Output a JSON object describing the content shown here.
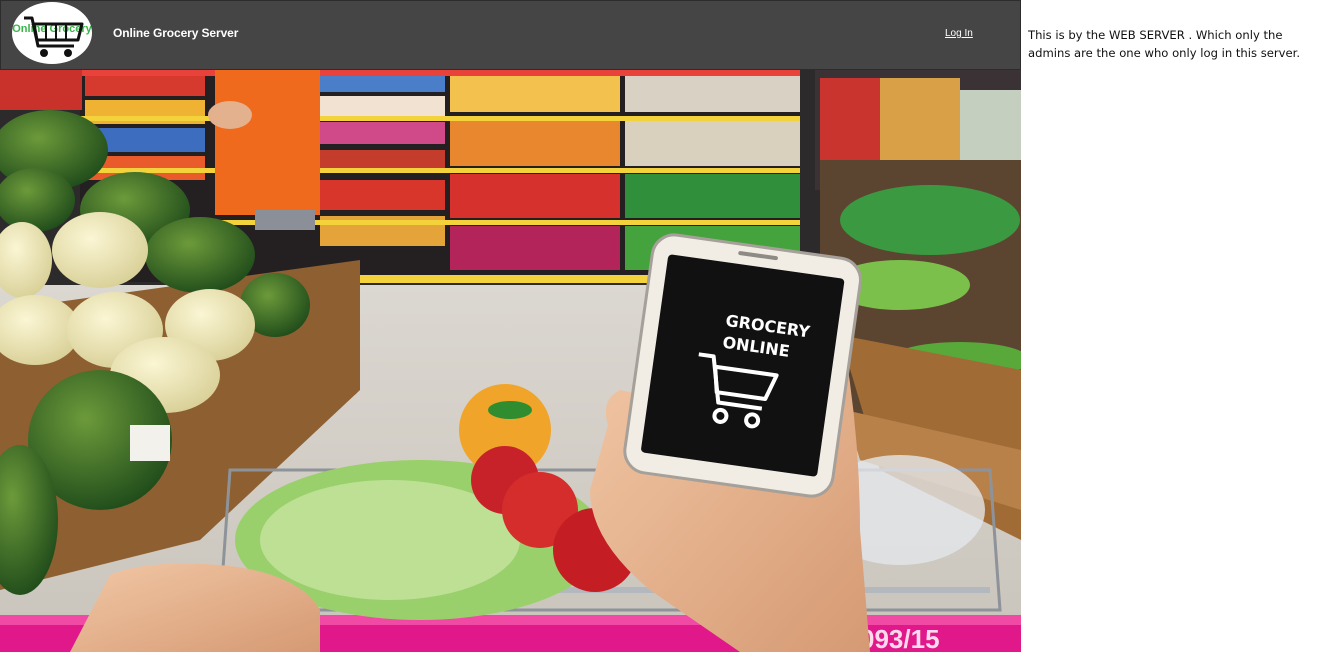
{
  "header": {
    "logo_text": "Online Grocery",
    "title": "Online Grocery Server",
    "login_label": "Log In"
  },
  "hero": {
    "phone_text_line1": "GROCERY",
    "phone_text_line2": "ONLINE",
    "cart_tag": "093/15"
  },
  "note": {
    "text": "This is by the WEB SERVER . Which only the admins are the one who only log in this server."
  }
}
